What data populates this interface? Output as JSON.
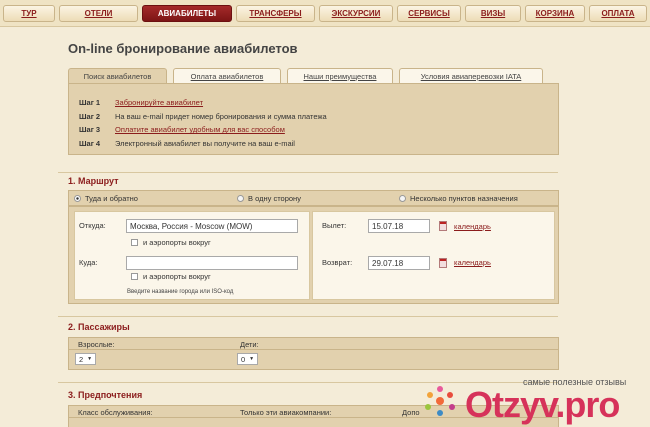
{
  "nav": {
    "items": [
      {
        "label": "ТУР",
        "active": false
      },
      {
        "label": "ОТЕЛИ",
        "active": false
      },
      {
        "label": "АВИАБИЛЕТЫ",
        "active": true
      },
      {
        "label": "ТРАНСФЕРЫ",
        "active": false
      },
      {
        "label": "ЭКСКУРСИИ",
        "active": false
      },
      {
        "label": "СЕРВИСЫ",
        "active": false
      },
      {
        "label": "ВИЗЫ",
        "active": false
      },
      {
        "label": "КОРЗИНА",
        "active": false
      },
      {
        "label": "ОПЛАТА",
        "active": false
      }
    ]
  },
  "page": {
    "title": "On-line бронирование авиабилетов"
  },
  "tabs": [
    {
      "label": "Поиск авиабилетов",
      "active": true
    },
    {
      "label": "Оплата авиабилетов",
      "active": false
    },
    {
      "label": "Наши преимущества",
      "active": false
    },
    {
      "label": "Условия авиаперевозки IATA",
      "active": false
    }
  ],
  "steps": [
    {
      "num": "Шаг 1",
      "text": "Забронируйте авиабилет",
      "link": true
    },
    {
      "num": "Шаг 2",
      "text": "На ваш e-mail придет номер бронирования и сумма платежа",
      "link": false
    },
    {
      "num": "Шаг 3",
      "text": "Оплатите авиабилет удобным для вас способом",
      "link": true
    },
    {
      "num": "Шаг 4",
      "text": "Электронный авиабилет вы получите на ваш e-mail",
      "link": false
    }
  ],
  "route": {
    "title": "1. Маршрут",
    "trip_types": [
      {
        "label": "Туда и обратно",
        "selected": true
      },
      {
        "label": "В одну сторону",
        "selected": false
      },
      {
        "label": "Несколько пунктов назначения",
        "selected": false
      }
    ],
    "from_label": "Откуда:",
    "from_value": "Москва, Россия - Moscow (MOW)",
    "from_nearby": "и аэропорты вокруг",
    "to_label": "Куда:",
    "to_value": "",
    "to_nearby": "и аэропорты вокруг",
    "hint": "Введите название города или ISO-код",
    "depart_label": "Вылет:",
    "depart_value": "15.07.18",
    "return_label": "Возврат:",
    "return_value": "29.07.18",
    "calendar_label": "календарь"
  },
  "passengers": {
    "title": "2. Пассажиры",
    "adults_label": "Взрослые:",
    "adults_value": "2",
    "children_label": "Дети:",
    "children_value": "0"
  },
  "preferences": {
    "title": "3. Предпочтения",
    "class_label": "Класс обслуживания:",
    "airlines_label": "Только эти авиакомпании:",
    "extra_label": "Допо"
  },
  "watermark": {
    "tagline": "самые полезные отзывы",
    "logo": "Otzyv.pro"
  },
  "colors": {
    "accent": "#8b1c1c",
    "background": "#f4ecd8",
    "panel": "#e2d1ae",
    "watermark": "#d6325a"
  }
}
